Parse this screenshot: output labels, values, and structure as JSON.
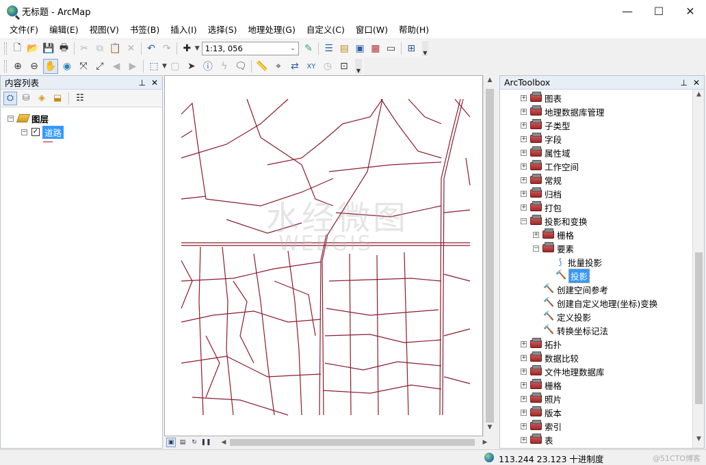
{
  "window": {
    "title": "无标题 - ArcMap",
    "minimize": "—",
    "maximize": "☐",
    "close": "✕"
  },
  "menu": [
    "文件(F)",
    "编辑(E)",
    "视图(V)",
    "书签(B)",
    "插入(I)",
    "选择(S)",
    "地理处理(G)",
    "自定义(C)",
    "窗口(W)",
    "帮助(H)"
  ],
  "toolbar": {
    "scale": "1:13, 056"
  },
  "toc": {
    "title": "内容列表",
    "pin": "⊥",
    "close": "✕",
    "root_label": "图层",
    "layer_label": "道路",
    "layer_checked": "✓",
    "colors": {
      "road": "#8b1a2e",
      "selection": "#3399ff"
    }
  },
  "map": {
    "watermark_cn": "水经微图",
    "watermark_en": "WEBGIS"
  },
  "arctoolbox": {
    "title": "ArcToolbox",
    "pin": "⊥",
    "close": "✕",
    "items": [
      {
        "label": "图表",
        "type": "toolbox",
        "level": 0,
        "expander": "+"
      },
      {
        "label": "地理数据库管理",
        "type": "toolbox",
        "level": 0,
        "expander": "+"
      },
      {
        "label": "子类型",
        "type": "toolbox",
        "level": 0,
        "expander": "+"
      },
      {
        "label": "字段",
        "type": "toolbox",
        "level": 0,
        "expander": "+"
      },
      {
        "label": "属性域",
        "type": "toolbox",
        "level": 0,
        "expander": "+"
      },
      {
        "label": "工作空间",
        "type": "toolbox",
        "level": 0,
        "expander": "+"
      },
      {
        "label": "常规",
        "type": "toolbox",
        "level": 0,
        "expander": "+"
      },
      {
        "label": "归档",
        "type": "toolbox",
        "level": 0,
        "expander": "+"
      },
      {
        "label": "打包",
        "type": "toolbox",
        "level": 0,
        "expander": "+"
      },
      {
        "label": "投影和变换",
        "type": "toolbox",
        "level": 0,
        "expander": "−"
      },
      {
        "label": "栅格",
        "type": "toolbox",
        "level": 1,
        "expander": "+"
      },
      {
        "label": "要素",
        "type": "toolbox",
        "level": 1,
        "expander": "−"
      },
      {
        "label": "批量投影",
        "type": "script",
        "level": 2,
        "expander": ""
      },
      {
        "label": "投影",
        "type": "tool",
        "level": 2,
        "expander": "",
        "selected": true
      },
      {
        "label": "创建空间参考",
        "type": "tool",
        "level": 1,
        "expander": ""
      },
      {
        "label": "创建自定义地理(坐标)变换",
        "type": "tool",
        "level": 1,
        "expander": ""
      },
      {
        "label": "定义投影",
        "type": "tool",
        "level": 1,
        "expander": ""
      },
      {
        "label": "转换坐标记法",
        "type": "tool",
        "level": 1,
        "expander": ""
      },
      {
        "label": "拓扑",
        "type": "toolbox",
        "level": 0,
        "expander": "+"
      },
      {
        "label": "数据比较",
        "type": "toolbox",
        "level": 0,
        "expander": "+"
      },
      {
        "label": "文件地理数据库",
        "type": "toolbox",
        "level": 0,
        "expander": "+"
      },
      {
        "label": "栅格",
        "type": "toolbox",
        "level": 0,
        "expander": "+"
      },
      {
        "label": "照片",
        "type": "toolbox",
        "level": 0,
        "expander": "+"
      },
      {
        "label": "版本",
        "type": "toolbox",
        "level": 0,
        "expander": "+"
      },
      {
        "label": "索引",
        "type": "toolbox",
        "level": 0,
        "expander": "+"
      },
      {
        "label": "表",
        "type": "toolbox",
        "level": 0,
        "expander": "+"
      }
    ]
  },
  "status": {
    "coords": "113.244  23.123 十进制度",
    "watermark": "@51CTO博客"
  }
}
